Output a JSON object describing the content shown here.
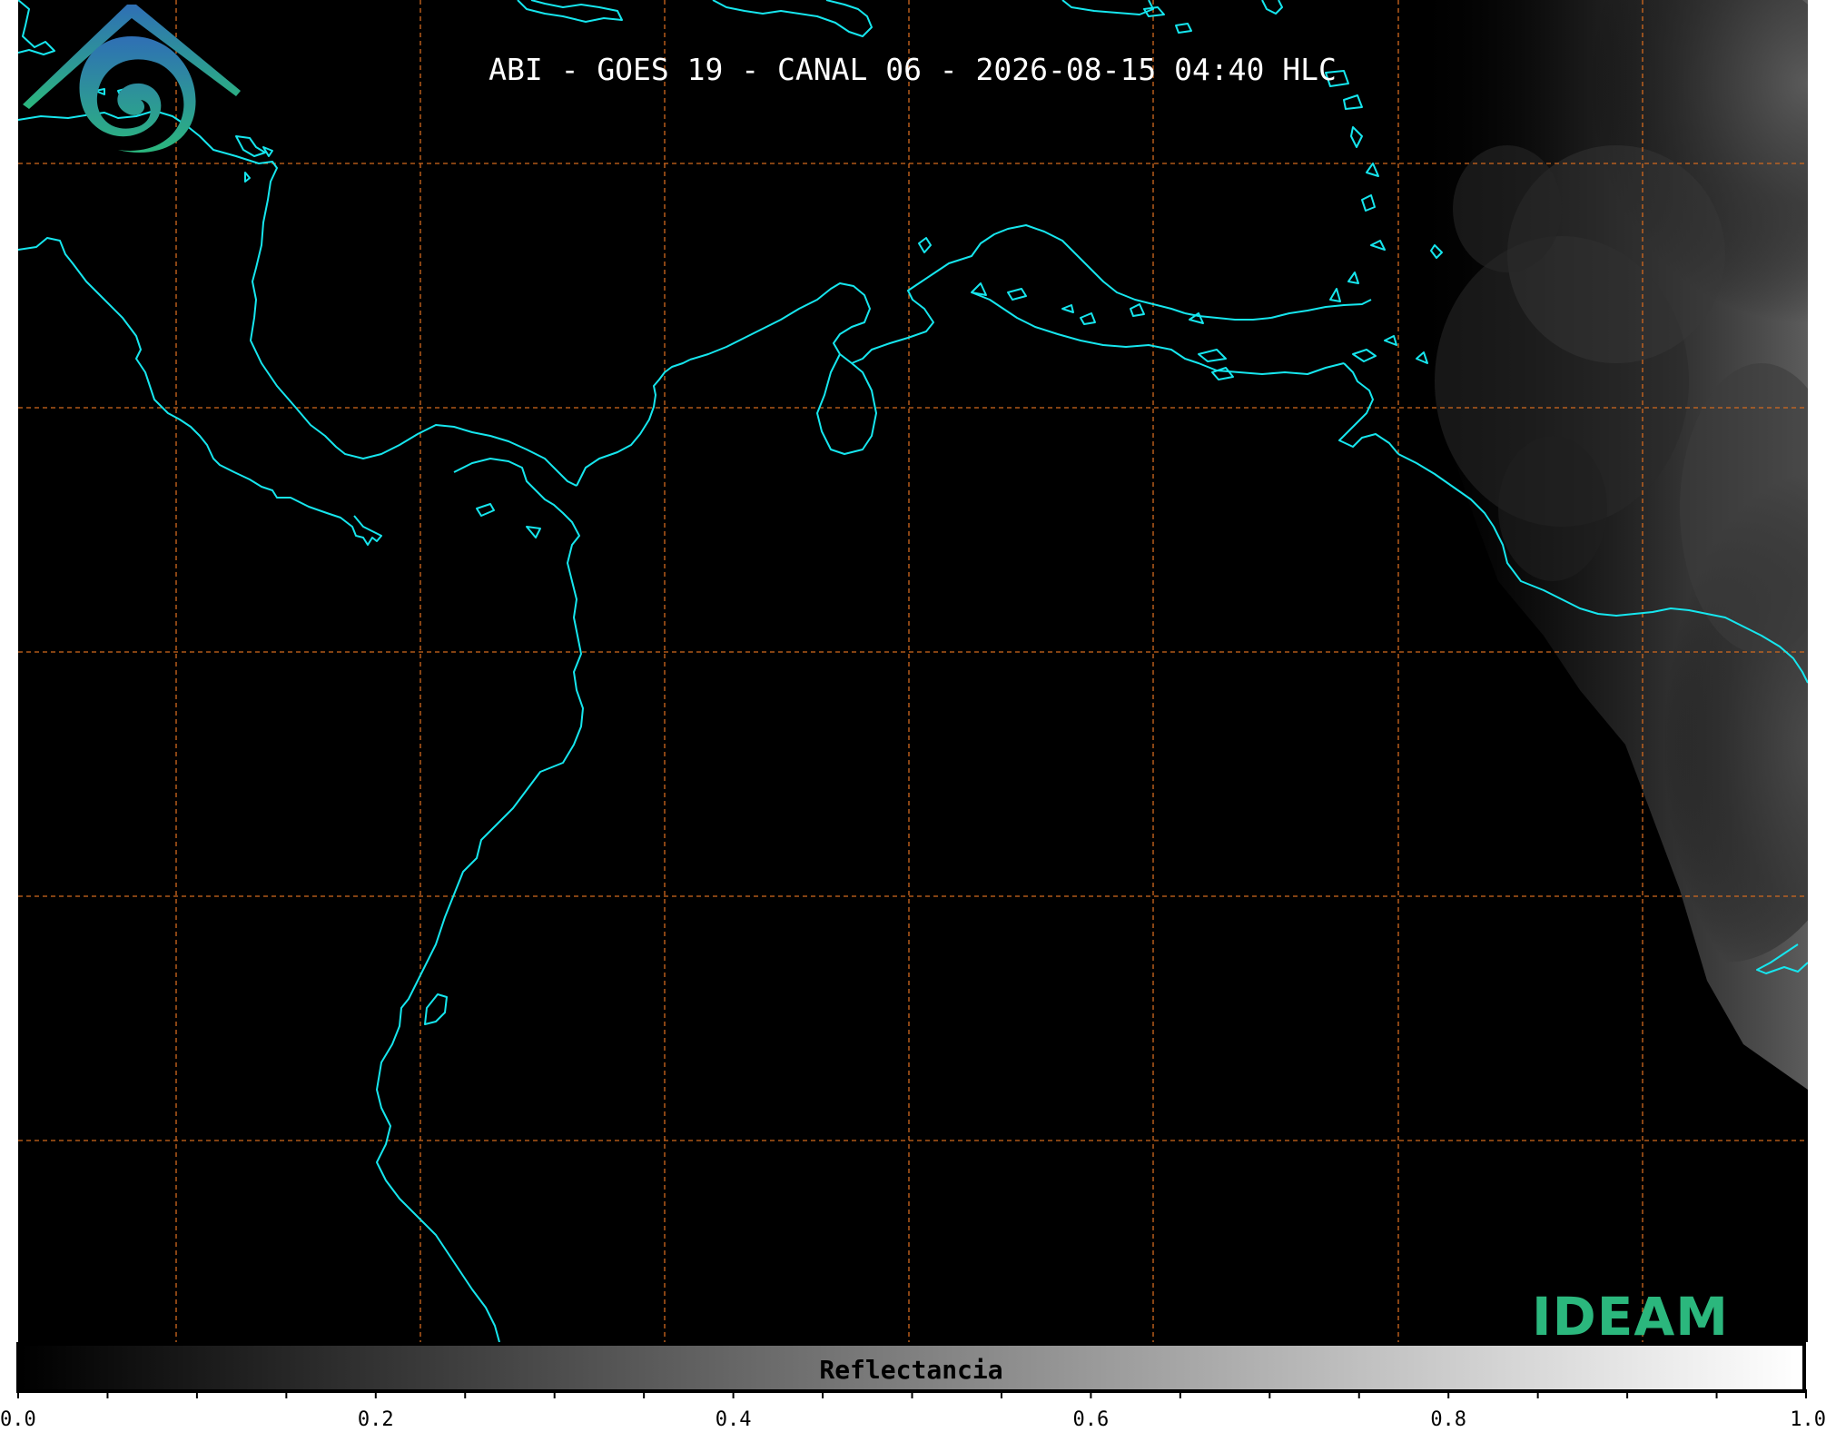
{
  "title": "ABI - GOES 19 - CANAL 06 - 2026-08-15 04:40 HLC",
  "logo": {
    "text": "IDEAM",
    "text_color": "#2bb77d",
    "gradient_top": "#2f6fb5",
    "gradient_bottom": "#2bb77d"
  },
  "colors": {
    "background": "#000000",
    "coastline": "#16e6ee",
    "gridline": "#d2691e"
  },
  "colorbar": {
    "label": "Reflectancia",
    "ticks": [
      "0.0",
      "0.2",
      "0.4",
      "0.6",
      "0.8",
      "1.0"
    ],
    "min": 0.0,
    "max": 1.0
  }
}
